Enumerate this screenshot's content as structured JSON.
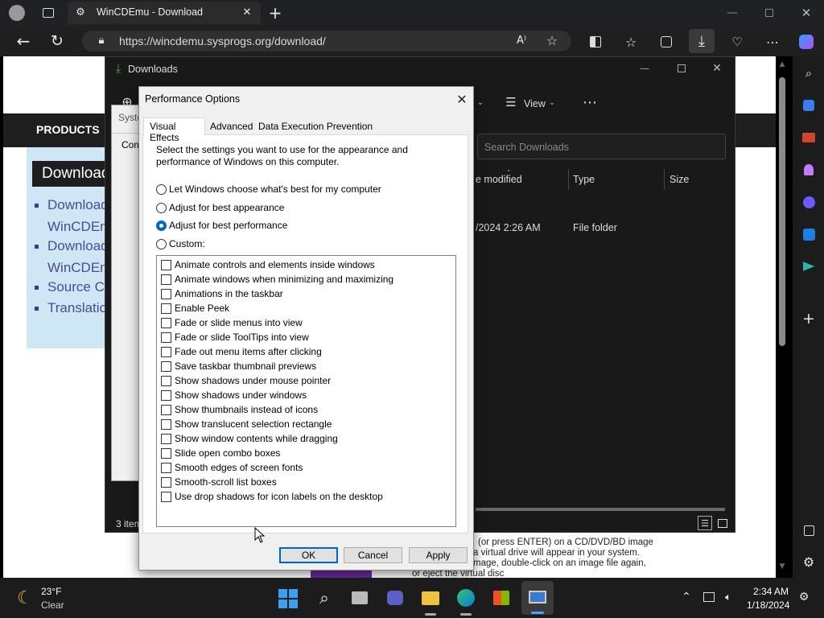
{
  "browser": {
    "tab_title": "WinCDEmu - Download",
    "url": "https://wincdemu.sysprogs.org/download/"
  },
  "webpage": {
    "nav_label": "PRODUCTS",
    "heading": "Download",
    "links": [
      "Download",
      "WinCDEm",
      "Download",
      "WinCDEm",
      "Source Co",
      "Translatio"
    ],
    "bottom_text": [
      "(or press ENTER) on a CD/DVD/BD image",
      "a virtual drive will appear in your system.",
      "mage, double-click on an image file again,",
      "or eject the virtual disc"
    ]
  },
  "explorer": {
    "title": "Downloads",
    "view_label": "View",
    "search_placeholder": "Search Downloads",
    "columns": [
      "e modified",
      "Type",
      "Size"
    ],
    "row": {
      "modified": "/2024 2:26 AM",
      "type": "File folder"
    },
    "status": "3 item"
  },
  "sysprops": {
    "title_frag": "Syste",
    "tab_frag": "Com"
  },
  "dialog": {
    "title": "Performance Options",
    "tabs": [
      "Visual Effects",
      "Advanced",
      "Data Execution Prevention"
    ],
    "description": [
      "Select the settings you want to use for the appearance and",
      "performance of Windows on this computer."
    ],
    "radios": [
      {
        "label": "Let Windows choose what's best for my computer",
        "checked": false
      },
      {
        "label": "Adjust for best appearance",
        "checked": false
      },
      {
        "label": "Adjust for best performance",
        "checked": true
      },
      {
        "label": "Custom:",
        "checked": false
      }
    ],
    "effects": [
      "Animate controls and elements inside windows",
      "Animate windows when minimizing and maximizing",
      "Animations in the taskbar",
      "Enable Peek",
      "Fade or slide menus into view",
      "Fade or slide ToolTips into view",
      "Fade out menu items after clicking",
      "Save taskbar thumbnail previews",
      "Show shadows under mouse pointer",
      "Show shadows under windows",
      "Show thumbnails instead of icons",
      "Show translucent selection rectangle",
      "Show window contents while dragging",
      "Slide open combo boxes",
      "Smooth edges of screen fonts",
      "Smooth-scroll list boxes",
      "Use drop shadows for icon labels on the desktop"
    ],
    "buttons": {
      "ok": "OK",
      "cancel": "Cancel",
      "apply": "Apply"
    }
  },
  "taskbar": {
    "weather_temp": "23°F",
    "weather_desc": "Clear",
    "time": "2:34 AM",
    "date": "1/18/2024"
  },
  "colors": {
    "accent": "#0067c0",
    "dark_chrome": "#202124",
    "taskbar": "#1c1c1c"
  }
}
